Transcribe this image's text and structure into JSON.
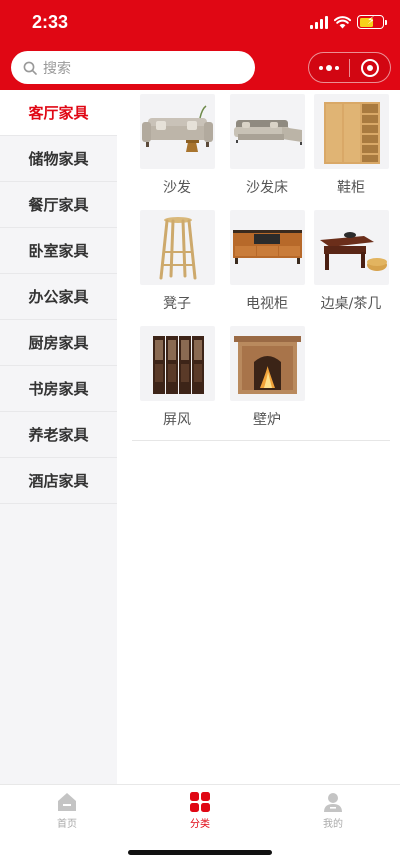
{
  "status_bar": {
    "time": "2:33"
  },
  "search": {
    "placeholder": "搜索"
  },
  "theme": {
    "accent": "#e00714",
    "sidebar_bg": "#f5f5f7"
  },
  "sidebar": {
    "items": [
      {
        "label": "客厅家具",
        "active": true
      },
      {
        "label": "储物家具"
      },
      {
        "label": "餐厅家具"
      },
      {
        "label": "卧室家具"
      },
      {
        "label": "办公家具"
      },
      {
        "label": "厨房家具"
      },
      {
        "label": "书房家具"
      },
      {
        "label": "养老家具"
      },
      {
        "label": "酒店家具"
      }
    ]
  },
  "products": [
    {
      "label": "沙发",
      "icon": "sofa-image"
    },
    {
      "label": "沙发床",
      "icon": "sofa-bed-image"
    },
    {
      "label": "鞋柜",
      "icon": "shoe-cabinet-image"
    },
    {
      "label": "凳子",
      "icon": "stool-image"
    },
    {
      "label": "电视柜",
      "icon": "tv-cabinet-image"
    },
    {
      "label": "边桌/茶几",
      "icon": "side-table-image"
    },
    {
      "label": "屏风",
      "icon": "folding-screen-image"
    },
    {
      "label": "壁炉",
      "icon": "fireplace-image"
    }
  ],
  "tabbar": {
    "tabs": [
      {
        "label": "首页",
        "icon": "home-icon"
      },
      {
        "label": "分类",
        "icon": "category-icon",
        "active": true
      },
      {
        "label": "我的",
        "icon": "user-icon"
      }
    ]
  }
}
